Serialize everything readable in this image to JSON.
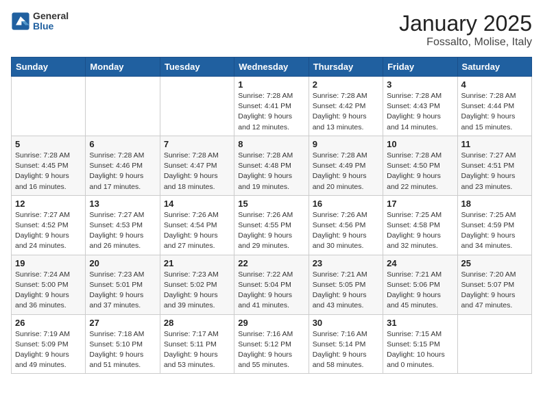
{
  "logo": {
    "general": "General",
    "blue": "Blue"
  },
  "title": "January 2025",
  "subtitle": "Fossalto, Molise, Italy",
  "weekdays": [
    "Sunday",
    "Monday",
    "Tuesday",
    "Wednesday",
    "Thursday",
    "Friday",
    "Saturday"
  ],
  "weeks": [
    [
      null,
      null,
      null,
      {
        "day": "1",
        "sunrise": "7:28 AM",
        "sunset": "4:41 PM",
        "daylight": "9 hours and 12 minutes."
      },
      {
        "day": "2",
        "sunrise": "7:28 AM",
        "sunset": "4:42 PM",
        "daylight": "9 hours and 13 minutes."
      },
      {
        "day": "3",
        "sunrise": "7:28 AM",
        "sunset": "4:43 PM",
        "daylight": "9 hours and 14 minutes."
      },
      {
        "day": "4",
        "sunrise": "7:28 AM",
        "sunset": "4:44 PM",
        "daylight": "9 hours and 15 minutes."
      }
    ],
    [
      {
        "day": "5",
        "sunrise": "7:28 AM",
        "sunset": "4:45 PM",
        "daylight": "9 hours and 16 minutes."
      },
      {
        "day": "6",
        "sunrise": "7:28 AM",
        "sunset": "4:46 PM",
        "daylight": "9 hours and 17 minutes."
      },
      {
        "day": "7",
        "sunrise": "7:28 AM",
        "sunset": "4:47 PM",
        "daylight": "9 hours and 18 minutes."
      },
      {
        "day": "8",
        "sunrise": "7:28 AM",
        "sunset": "4:48 PM",
        "daylight": "9 hours and 19 minutes."
      },
      {
        "day": "9",
        "sunrise": "7:28 AM",
        "sunset": "4:49 PM",
        "daylight": "9 hours and 20 minutes."
      },
      {
        "day": "10",
        "sunrise": "7:28 AM",
        "sunset": "4:50 PM",
        "daylight": "9 hours and 22 minutes."
      },
      {
        "day": "11",
        "sunrise": "7:27 AM",
        "sunset": "4:51 PM",
        "daylight": "9 hours and 23 minutes."
      }
    ],
    [
      {
        "day": "12",
        "sunrise": "7:27 AM",
        "sunset": "4:52 PM",
        "daylight": "9 hours and 24 minutes."
      },
      {
        "day": "13",
        "sunrise": "7:27 AM",
        "sunset": "4:53 PM",
        "daylight": "9 hours and 26 minutes."
      },
      {
        "day": "14",
        "sunrise": "7:26 AM",
        "sunset": "4:54 PM",
        "daylight": "9 hours and 27 minutes."
      },
      {
        "day": "15",
        "sunrise": "7:26 AM",
        "sunset": "4:55 PM",
        "daylight": "9 hours and 29 minutes."
      },
      {
        "day": "16",
        "sunrise": "7:26 AM",
        "sunset": "4:56 PM",
        "daylight": "9 hours and 30 minutes."
      },
      {
        "day": "17",
        "sunrise": "7:25 AM",
        "sunset": "4:58 PM",
        "daylight": "9 hours and 32 minutes."
      },
      {
        "day": "18",
        "sunrise": "7:25 AM",
        "sunset": "4:59 PM",
        "daylight": "9 hours and 34 minutes."
      }
    ],
    [
      {
        "day": "19",
        "sunrise": "7:24 AM",
        "sunset": "5:00 PM",
        "daylight": "9 hours and 36 minutes."
      },
      {
        "day": "20",
        "sunrise": "7:23 AM",
        "sunset": "5:01 PM",
        "daylight": "9 hours and 37 minutes."
      },
      {
        "day": "21",
        "sunrise": "7:23 AM",
        "sunset": "5:02 PM",
        "daylight": "9 hours and 39 minutes."
      },
      {
        "day": "22",
        "sunrise": "7:22 AM",
        "sunset": "5:04 PM",
        "daylight": "9 hours and 41 minutes."
      },
      {
        "day": "23",
        "sunrise": "7:21 AM",
        "sunset": "5:05 PM",
        "daylight": "9 hours and 43 minutes."
      },
      {
        "day": "24",
        "sunrise": "7:21 AM",
        "sunset": "5:06 PM",
        "daylight": "9 hours and 45 minutes."
      },
      {
        "day": "25",
        "sunrise": "7:20 AM",
        "sunset": "5:07 PM",
        "daylight": "9 hours and 47 minutes."
      }
    ],
    [
      {
        "day": "26",
        "sunrise": "7:19 AM",
        "sunset": "5:09 PM",
        "daylight": "9 hours and 49 minutes."
      },
      {
        "day": "27",
        "sunrise": "7:18 AM",
        "sunset": "5:10 PM",
        "daylight": "9 hours and 51 minutes."
      },
      {
        "day": "28",
        "sunrise": "7:17 AM",
        "sunset": "5:11 PM",
        "daylight": "9 hours and 53 minutes."
      },
      {
        "day": "29",
        "sunrise": "7:16 AM",
        "sunset": "5:12 PM",
        "daylight": "9 hours and 55 minutes."
      },
      {
        "day": "30",
        "sunrise": "7:16 AM",
        "sunset": "5:14 PM",
        "daylight": "9 hours and 58 minutes."
      },
      {
        "day": "31",
        "sunrise": "7:15 AM",
        "sunset": "5:15 PM",
        "daylight": "10 hours and 0 minutes."
      },
      null
    ]
  ]
}
